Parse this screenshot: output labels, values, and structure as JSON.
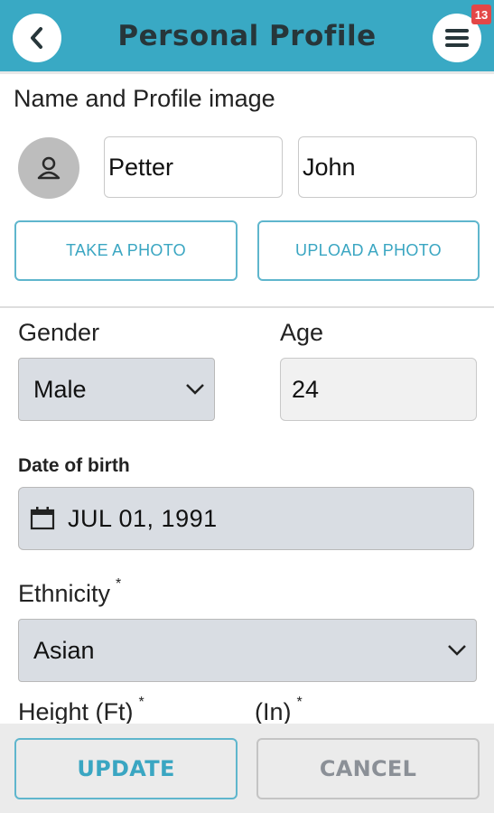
{
  "header": {
    "title": "Personal Profile",
    "notification_count": "13",
    "accent_color": "#39a9c4"
  },
  "profile": {
    "section_title": "Name and Profile image",
    "first_name": "Petter",
    "last_name": "John",
    "take_photo_label": "TAKE A PHOTO",
    "upload_photo_label": "UPLOAD A PHOTO"
  },
  "details": {
    "gender_label": "Gender",
    "gender_value": "Male",
    "age_label": "Age",
    "age_value": "24",
    "dob_label": "Date of birth",
    "dob_value": "JUL 01, 1991",
    "ethnicity_label": "Ethnicity",
    "ethnicity_value": "Asian",
    "height_ft_label": "Height (Ft)",
    "height_in_label": "(In)",
    "required_mark": "*"
  },
  "footer": {
    "update_label": "UPDATE",
    "cancel_label": "CANCEL"
  },
  "icons": {
    "back": "chevron-left-icon",
    "menu": "hamburger-menu-icon",
    "avatar": "user-icon",
    "calendar": "calendar-icon",
    "dropdown": "chevron-down-icon"
  }
}
